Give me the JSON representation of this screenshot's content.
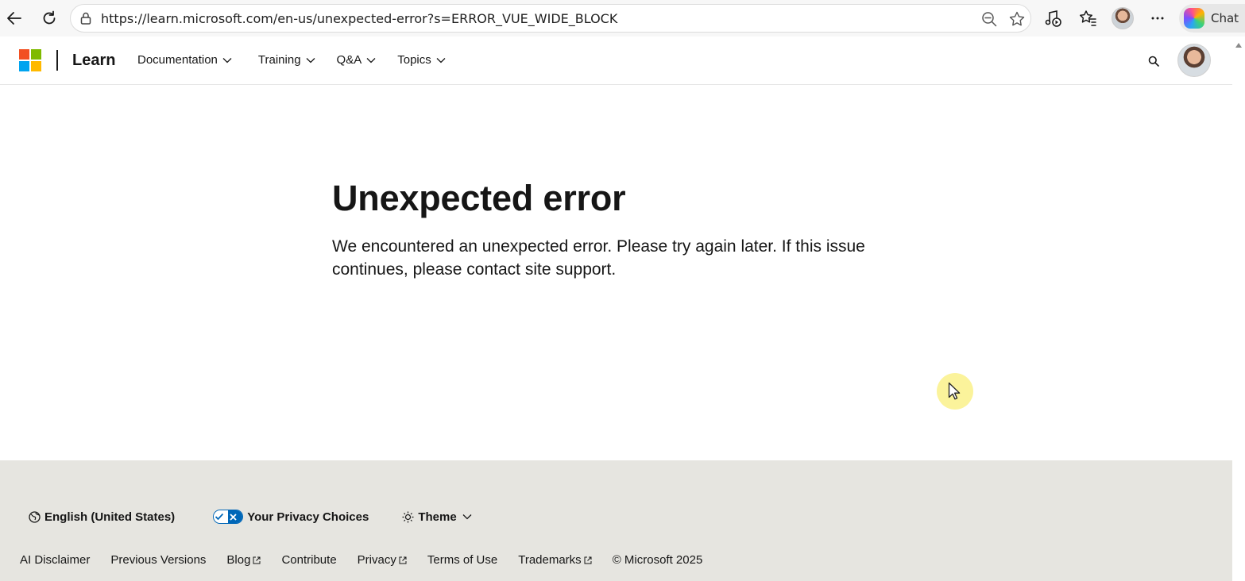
{
  "browser": {
    "url": "https://learn.microsoft.com/en-us/unexpected-error?s=ERROR_VUE_WIDE_BLOCK",
    "chat_label": "Chat"
  },
  "header": {
    "brand": "Learn",
    "nav": [
      {
        "label": "Documentation"
      },
      {
        "label": "Training"
      },
      {
        "label": "Q&A"
      },
      {
        "label": "Topics"
      }
    ]
  },
  "main": {
    "title": "Unexpected error",
    "message": "We encountered an unexpected error. Please try again later. If this issue continues, please contact site support."
  },
  "footer": {
    "language": "English (United States)",
    "privacy": "Your Privacy Choices",
    "theme": "Theme",
    "links": [
      {
        "label": "AI Disclaimer",
        "external": false
      },
      {
        "label": "Previous Versions",
        "external": false
      },
      {
        "label": "Blog",
        "external": true
      },
      {
        "label": "Contribute",
        "external": false
      },
      {
        "label": "Privacy",
        "external": true
      },
      {
        "label": "Terms of Use",
        "external": false
      },
      {
        "label": "Trademarks",
        "external": true
      }
    ],
    "copyright": "© Microsoft 2025"
  },
  "colors": {
    "ms_red": "#f25022",
    "ms_green": "#7fba00",
    "ms_blue": "#00a4ef",
    "ms_yellow": "#ffb900",
    "footer_bg": "#e6e5e0",
    "accent": "#0067b8"
  },
  "icons": [
    "back-icon",
    "refresh-icon",
    "lock-icon",
    "zoom-out-icon",
    "favorite-star-icon",
    "media-icon",
    "favorites-icon",
    "more-icon",
    "copilot-icon",
    "search-icon",
    "globe-icon",
    "sun-icon",
    "external-link-icon"
  ]
}
